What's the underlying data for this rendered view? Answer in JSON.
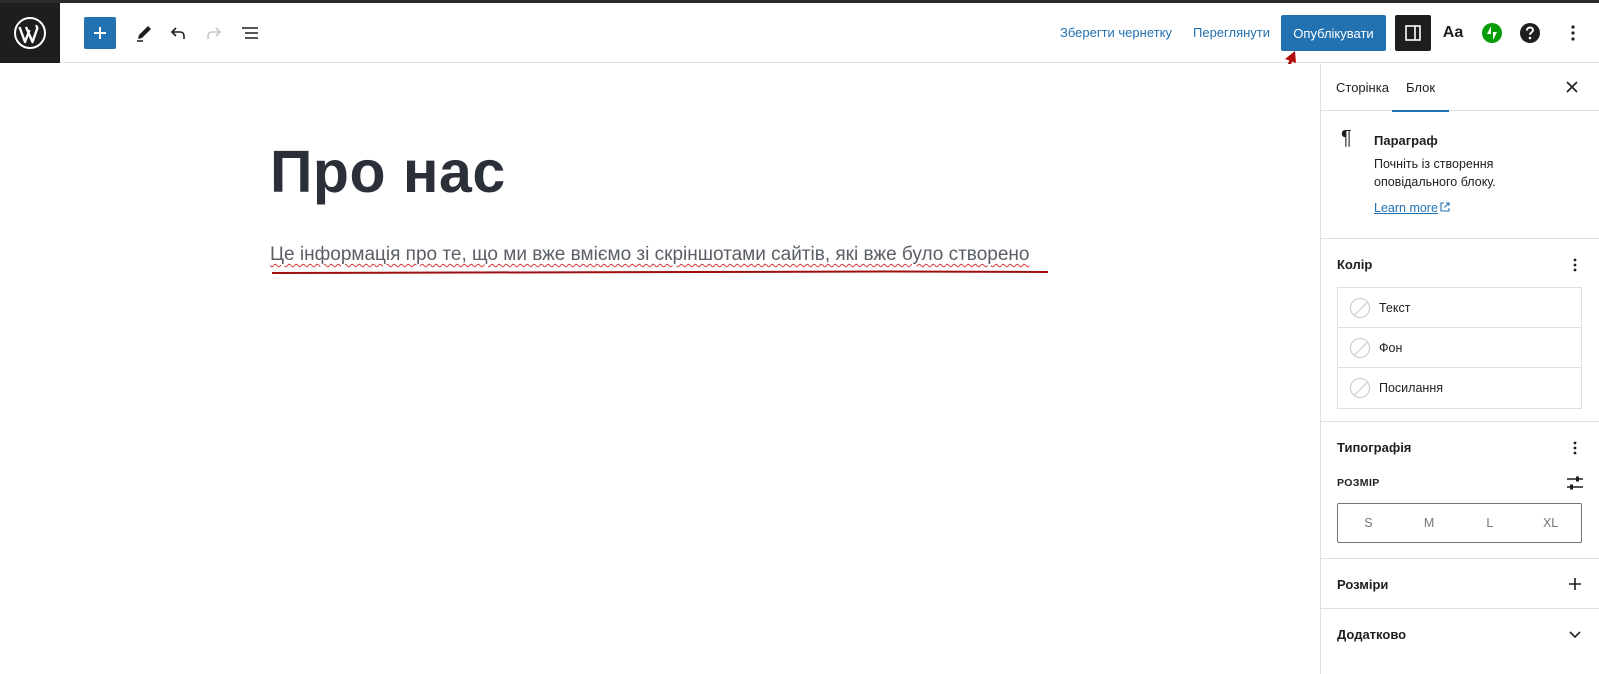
{
  "toolbar": {
    "save_draft": "Зберегти чернетку",
    "preview": "Переглянути",
    "publish": "Опублікувати",
    "styles": "Aa"
  },
  "editor": {
    "title": "Про нас",
    "paragraph": "Це інформація про те, що ми вже вміємо зі скріншотами сайтів, які вже було створено"
  },
  "sidebar": {
    "tabs": [
      "Сторінка",
      "Блок"
    ],
    "block": {
      "name": "Параграф",
      "description": "Почніть із створення оповідального блоку.",
      "learn_more": "Learn more"
    },
    "color": {
      "title": "Колір",
      "items": [
        "Текст",
        "Фон",
        "Посилання"
      ]
    },
    "typography": {
      "title": "Типографія",
      "size_label": "РОЗМІР",
      "sizes": [
        "S",
        "M",
        "L",
        "XL"
      ]
    },
    "dimensions": {
      "title": "Розміри"
    },
    "advanced": {
      "title": "Додатково"
    }
  },
  "colors": {
    "accent": "#2271b1",
    "dark": "#1e1e1e",
    "annotation": "#b30f0f"
  }
}
